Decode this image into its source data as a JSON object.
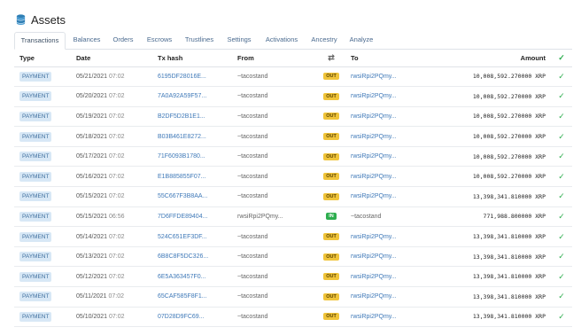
{
  "header": {
    "title": "Assets",
    "icon": "coins-stack-icon"
  },
  "tabs": [
    {
      "label": "Transactions",
      "active": true
    },
    {
      "label": "Balances"
    },
    {
      "label": "Orders"
    },
    {
      "label": "Escrows"
    },
    {
      "label": "Trustlines"
    },
    {
      "label": "Settings"
    },
    {
      "label": "Activations"
    },
    {
      "label": "Ancestry"
    },
    {
      "label": "Analyze"
    }
  ],
  "table": {
    "columns": {
      "type": "Type",
      "date": "Date",
      "hash": "Tx hash",
      "from": "From",
      "direction": "⇄",
      "to": "To",
      "amount": "Amount",
      "status": "✓"
    },
    "rows": [
      {
        "type": "PAYMENT",
        "date": "05/21/2021",
        "time": "07:02",
        "hash": "6195DF28016E...",
        "from": "~tacostand",
        "dir": "OUT",
        "to": "rwsiRpi2PQmy...",
        "amount": "10,008,592.270000 XRP",
        "status": "✓"
      },
      {
        "type": "PAYMENT",
        "date": "05/20/2021",
        "time": "07:02",
        "hash": "7A0A92A59F57...",
        "from": "~tacostand",
        "dir": "OUT",
        "to": "rwsiRpi2PQmy...",
        "amount": "10,008,592.270000 XRP",
        "status": "✓"
      },
      {
        "type": "PAYMENT",
        "date": "05/19/2021",
        "time": "07:02",
        "hash": "B2DF5D2B1E1...",
        "from": "~tacostand",
        "dir": "OUT",
        "to": "rwsiRpi2PQmy...",
        "amount": "10,008,592.270000 XRP",
        "status": "✓"
      },
      {
        "type": "PAYMENT",
        "date": "05/18/2021",
        "time": "07:02",
        "hash": "B03B461E8272...",
        "from": "~tacostand",
        "dir": "OUT",
        "to": "rwsiRpi2PQmy...",
        "amount": "10,008,592.270000 XRP",
        "status": "✓"
      },
      {
        "type": "PAYMENT",
        "date": "05/17/2021",
        "time": "07:02",
        "hash": "71F6093B1780...",
        "from": "~tacostand",
        "dir": "OUT",
        "to": "rwsiRpi2PQmy...",
        "amount": "10,008,592.270000 XRP",
        "status": "✓"
      },
      {
        "type": "PAYMENT",
        "date": "05/16/2021",
        "time": "07:02",
        "hash": "E1B885855F07...",
        "from": "~tacostand",
        "dir": "OUT",
        "to": "rwsiRpi2PQmy...",
        "amount": "10,008,592.270000 XRP",
        "status": "✓"
      },
      {
        "type": "PAYMENT",
        "date": "05/15/2021",
        "time": "07:02",
        "hash": "55C667F3B8AA...",
        "from": "~tacostand",
        "dir": "OUT",
        "to": "rwsiRpi2PQmy...",
        "amount": "13,398,341.810000 XRP",
        "status": "✓"
      },
      {
        "type": "PAYMENT",
        "date": "05/15/2021",
        "time": "06:56",
        "hash": "7D6FFDE89404...",
        "from": "rwsiRpi2PQmy...",
        "dir": "IN",
        "to": "~tacostand",
        "amount": "771,988.800000 XRP",
        "status": "✓"
      },
      {
        "type": "PAYMENT",
        "date": "05/14/2021",
        "time": "07:02",
        "hash": "524C651EF3DF...",
        "from": "~tacostand",
        "dir": "OUT",
        "to": "rwsiRpi2PQmy...",
        "amount": "13,398,341.810000 XRP",
        "status": "✓"
      },
      {
        "type": "PAYMENT",
        "date": "05/13/2021",
        "time": "07:02",
        "hash": "6B8C8F5DC326...",
        "from": "~tacostand",
        "dir": "OUT",
        "to": "rwsiRpi2PQmy...",
        "amount": "13,398,341.810000 XRP",
        "status": "✓"
      },
      {
        "type": "PAYMENT",
        "date": "05/12/2021",
        "time": "07:02",
        "hash": "6E5A363457F0...",
        "from": "~tacostand",
        "dir": "OUT",
        "to": "rwsiRpi2PQmy...",
        "amount": "13,398,341.810000 XRP",
        "status": "✓"
      },
      {
        "type": "PAYMENT",
        "date": "05/11/2021",
        "time": "07:02",
        "hash": "65CAF585F8F1...",
        "from": "~tacostand",
        "dir": "OUT",
        "to": "rwsiRpi2PQmy...",
        "amount": "13,398,341.810000 XRP",
        "status": "✓"
      },
      {
        "type": "PAYMENT",
        "date": "05/10/2021",
        "time": "07:02",
        "hash": "07D28D9FC69...",
        "from": "~tacostand",
        "dir": "OUT",
        "to": "rwsiRpi2PQmy...",
        "amount": "13,398,341.810000 XRP",
        "status": "✓"
      }
    ]
  },
  "colors": {
    "accent": "#3f79b8",
    "out_badge": "#f0c43a",
    "in_badge": "#2eae4f",
    "type_badge": "#d8e8f6"
  }
}
